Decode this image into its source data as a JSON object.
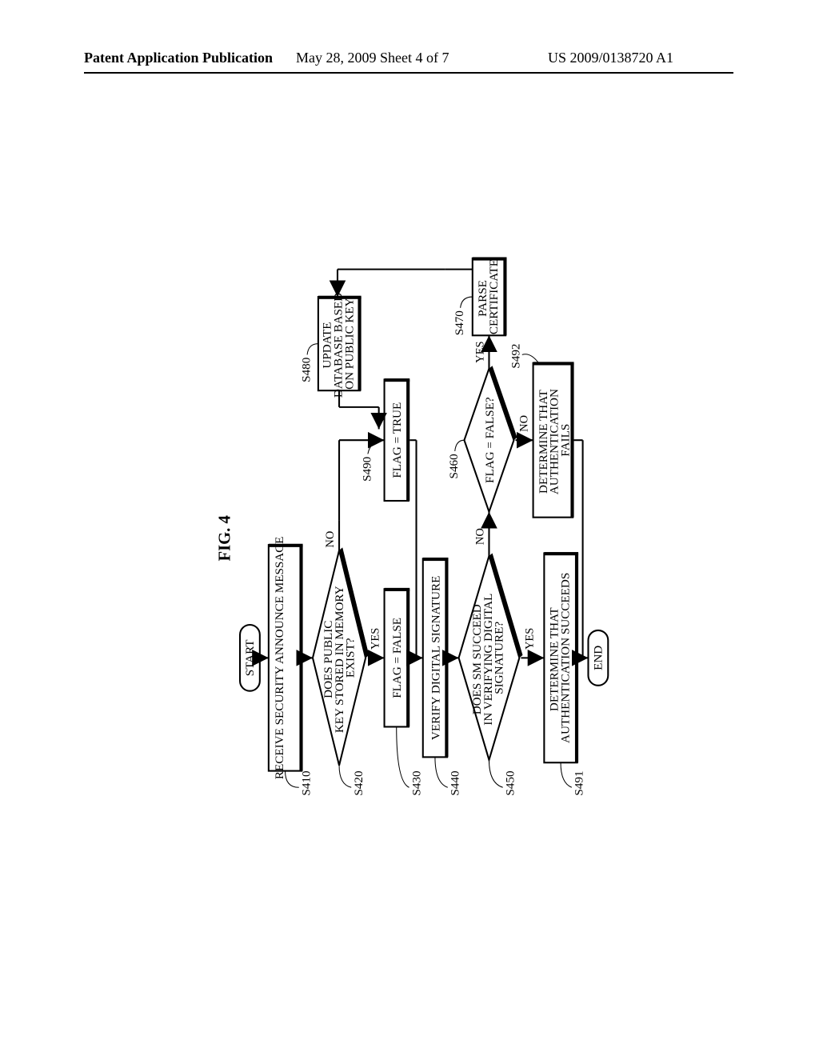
{
  "header": {
    "left": "Patent Application Publication",
    "middle": "May 28, 2009  Sheet 4 of 7",
    "right": "US 2009/0138720 A1"
  },
  "figure_label": "FIG. 4",
  "nodes": {
    "start": "START",
    "end": "END",
    "s410": "RECEIVE SECURITY ANNOUNCE MESSAGE",
    "s420": "DOES PUBLIC KEY STORED IN MEMORY EXIST?",
    "s430": "FLAG = FALSE",
    "s440": "VERIFY DIGITAL SIGNATURE",
    "s450": "DOES SM SUCCEED IN VERIFYING DIGITAL SIGNATURE?",
    "s460": "FLAG = FALSE?",
    "s470": "PARSE CERTIFICATE",
    "s480": "UPDATE DATABASE BASED ON PUBLIC KEY",
    "s490": "FLAG = TRUE",
    "s491": "DETERMINE THAT AUTHENTICATION SUCCEEDS",
    "s492": "DETERMINE THAT AUTHENTICATION FAILS"
  },
  "refs": {
    "s410": "S410",
    "s420": "S420",
    "s430": "S430",
    "s440": "S440",
    "s450": "S450",
    "s460": "S460",
    "s470": "S470",
    "s480": "S480",
    "s490": "S490",
    "s491": "S491",
    "s492": "S492"
  },
  "edges": {
    "yes": "YES",
    "no": "NO"
  },
  "chart_data": {
    "type": "flowchart",
    "title": "FIG. 4",
    "nodes": [
      {
        "id": "start",
        "type": "terminator",
        "label": "START"
      },
      {
        "id": "S410",
        "type": "process",
        "label": "RECEIVE SECURITY ANNOUNCE MESSAGE"
      },
      {
        "id": "S420",
        "type": "decision",
        "label": "DOES PUBLIC KEY STORED IN MEMORY EXIST?"
      },
      {
        "id": "S430",
        "type": "process",
        "label": "FLAG = FALSE"
      },
      {
        "id": "S490",
        "type": "process",
        "label": "FLAG = TRUE"
      },
      {
        "id": "S440",
        "type": "process",
        "label": "VERIFY DIGITAL SIGNATURE"
      },
      {
        "id": "S450",
        "type": "decision",
        "label": "DOES SM SUCCEED IN VERIFYING DIGITAL SIGNATURE?"
      },
      {
        "id": "S460",
        "type": "decision",
        "label": "FLAG = FALSE?"
      },
      {
        "id": "S470",
        "type": "process",
        "label": "PARSE CERTIFICATE"
      },
      {
        "id": "S480",
        "type": "process",
        "label": "UPDATE DATABASE BASED ON PUBLIC KEY"
      },
      {
        "id": "S491",
        "type": "process",
        "label": "DETERMINE THAT AUTHENTICATION SUCCEEDS"
      },
      {
        "id": "S492",
        "type": "process",
        "label": "DETERMINE THAT AUTHENTICATION FAILS"
      },
      {
        "id": "end",
        "type": "terminator",
        "label": "END"
      }
    ],
    "edges": [
      {
        "from": "start",
        "to": "S410"
      },
      {
        "from": "S410",
        "to": "S420"
      },
      {
        "from": "S420",
        "to": "S430",
        "label": "YES"
      },
      {
        "from": "S420",
        "to": "S490",
        "label": "NO"
      },
      {
        "from": "S430",
        "to": "S440"
      },
      {
        "from": "S490",
        "to": "S440"
      },
      {
        "from": "S440",
        "to": "S450"
      },
      {
        "from": "S450",
        "to": "S491",
        "label": "YES"
      },
      {
        "from": "S450",
        "to": "S460",
        "label": "NO"
      },
      {
        "from": "S460",
        "to": "S470",
        "label": "YES"
      },
      {
        "from": "S460",
        "to": "S492",
        "label": "NO"
      },
      {
        "from": "S470",
        "to": "S480"
      },
      {
        "from": "S480",
        "to": "S490"
      },
      {
        "from": "S491",
        "to": "end"
      },
      {
        "from": "S492",
        "to": "end"
      }
    ]
  }
}
